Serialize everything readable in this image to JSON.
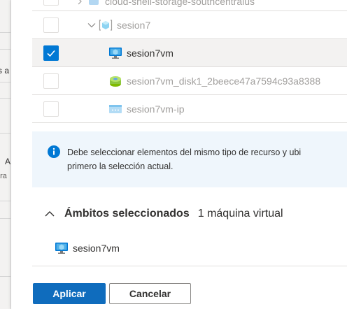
{
  "background_blade": {
    "fragments": [
      "s a",
      "A",
      "ara"
    ]
  },
  "tree": {
    "rows": [
      {
        "label": "cloud-shell-storage-southcentralus",
        "checked": false,
        "muted": true
      },
      {
        "label": "sesion7",
        "checked": false,
        "muted": true
      },
      {
        "label": "sesion7vm",
        "checked": true,
        "muted": false
      },
      {
        "label": "sesion7vm_disk1_2beece47a7594c93a8388",
        "checked": false,
        "muted": true
      },
      {
        "label": "sesion7vm-ip",
        "checked": false,
        "muted": true
      }
    ]
  },
  "info": {
    "line1": "Debe seleccionar elementos del mismo tipo de recurso y ubi",
    "line2": "primero la selección actual."
  },
  "scopes": {
    "title": "Ámbitos seleccionados",
    "count": "1 máquina virtual",
    "items": [
      {
        "label": "sesion7vm"
      }
    ]
  },
  "footer": {
    "apply_label": "Aplicar",
    "cancel_label": "Cancelar"
  },
  "colors": {
    "accent": "#0078d4",
    "primary_button": "#0f6cbd",
    "info_bg": "#eff6fc",
    "selected_row_bg": "#f3f2f1",
    "muted_text": "#a19f9d"
  }
}
